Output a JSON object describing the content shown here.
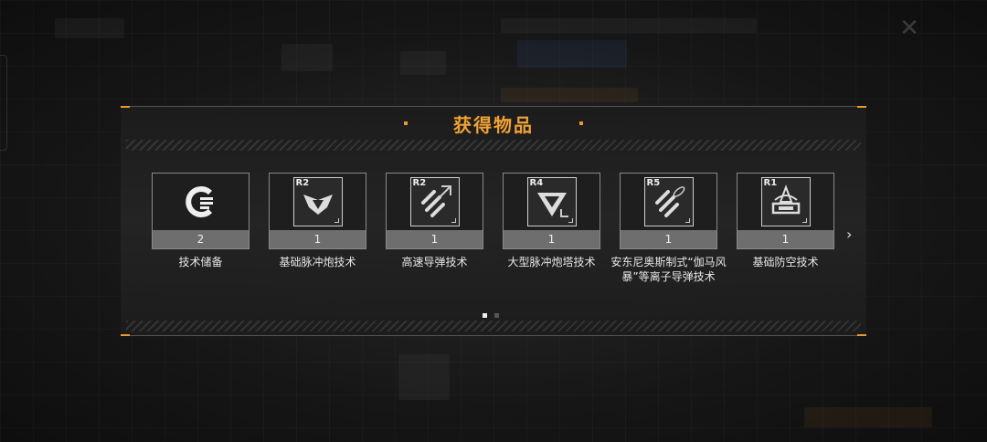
{
  "dialog": {
    "title": "获得物品"
  },
  "items": [
    {
      "name": "技术储备",
      "count": "2",
      "rank": "",
      "icon": "tech-reserve-icon"
    },
    {
      "name": "基础脉冲炮技术",
      "count": "1",
      "rank": "R2",
      "icon": "pulse-cannon-icon"
    },
    {
      "name": "高速导弹技术",
      "count": "1",
      "rank": "R2",
      "icon": "missile-icon"
    },
    {
      "name": "大型脉冲炮塔技术",
      "count": "1",
      "rank": "R4",
      "icon": "pulse-turret-icon"
    },
    {
      "name": "安东尼奥斯制式“伽马风暴”等离子导弹技术",
      "count": "1",
      "rank": "R5",
      "icon": "plasma-missile-icon"
    },
    {
      "name": "基础防空技术",
      "count": "1",
      "rank": "R1",
      "icon": "anti-air-icon"
    }
  ],
  "pager": {
    "pages": 2,
    "current": 1
  },
  "colors": {
    "accent": "#f0a234",
    "count_bar": "#6e6e6e"
  }
}
